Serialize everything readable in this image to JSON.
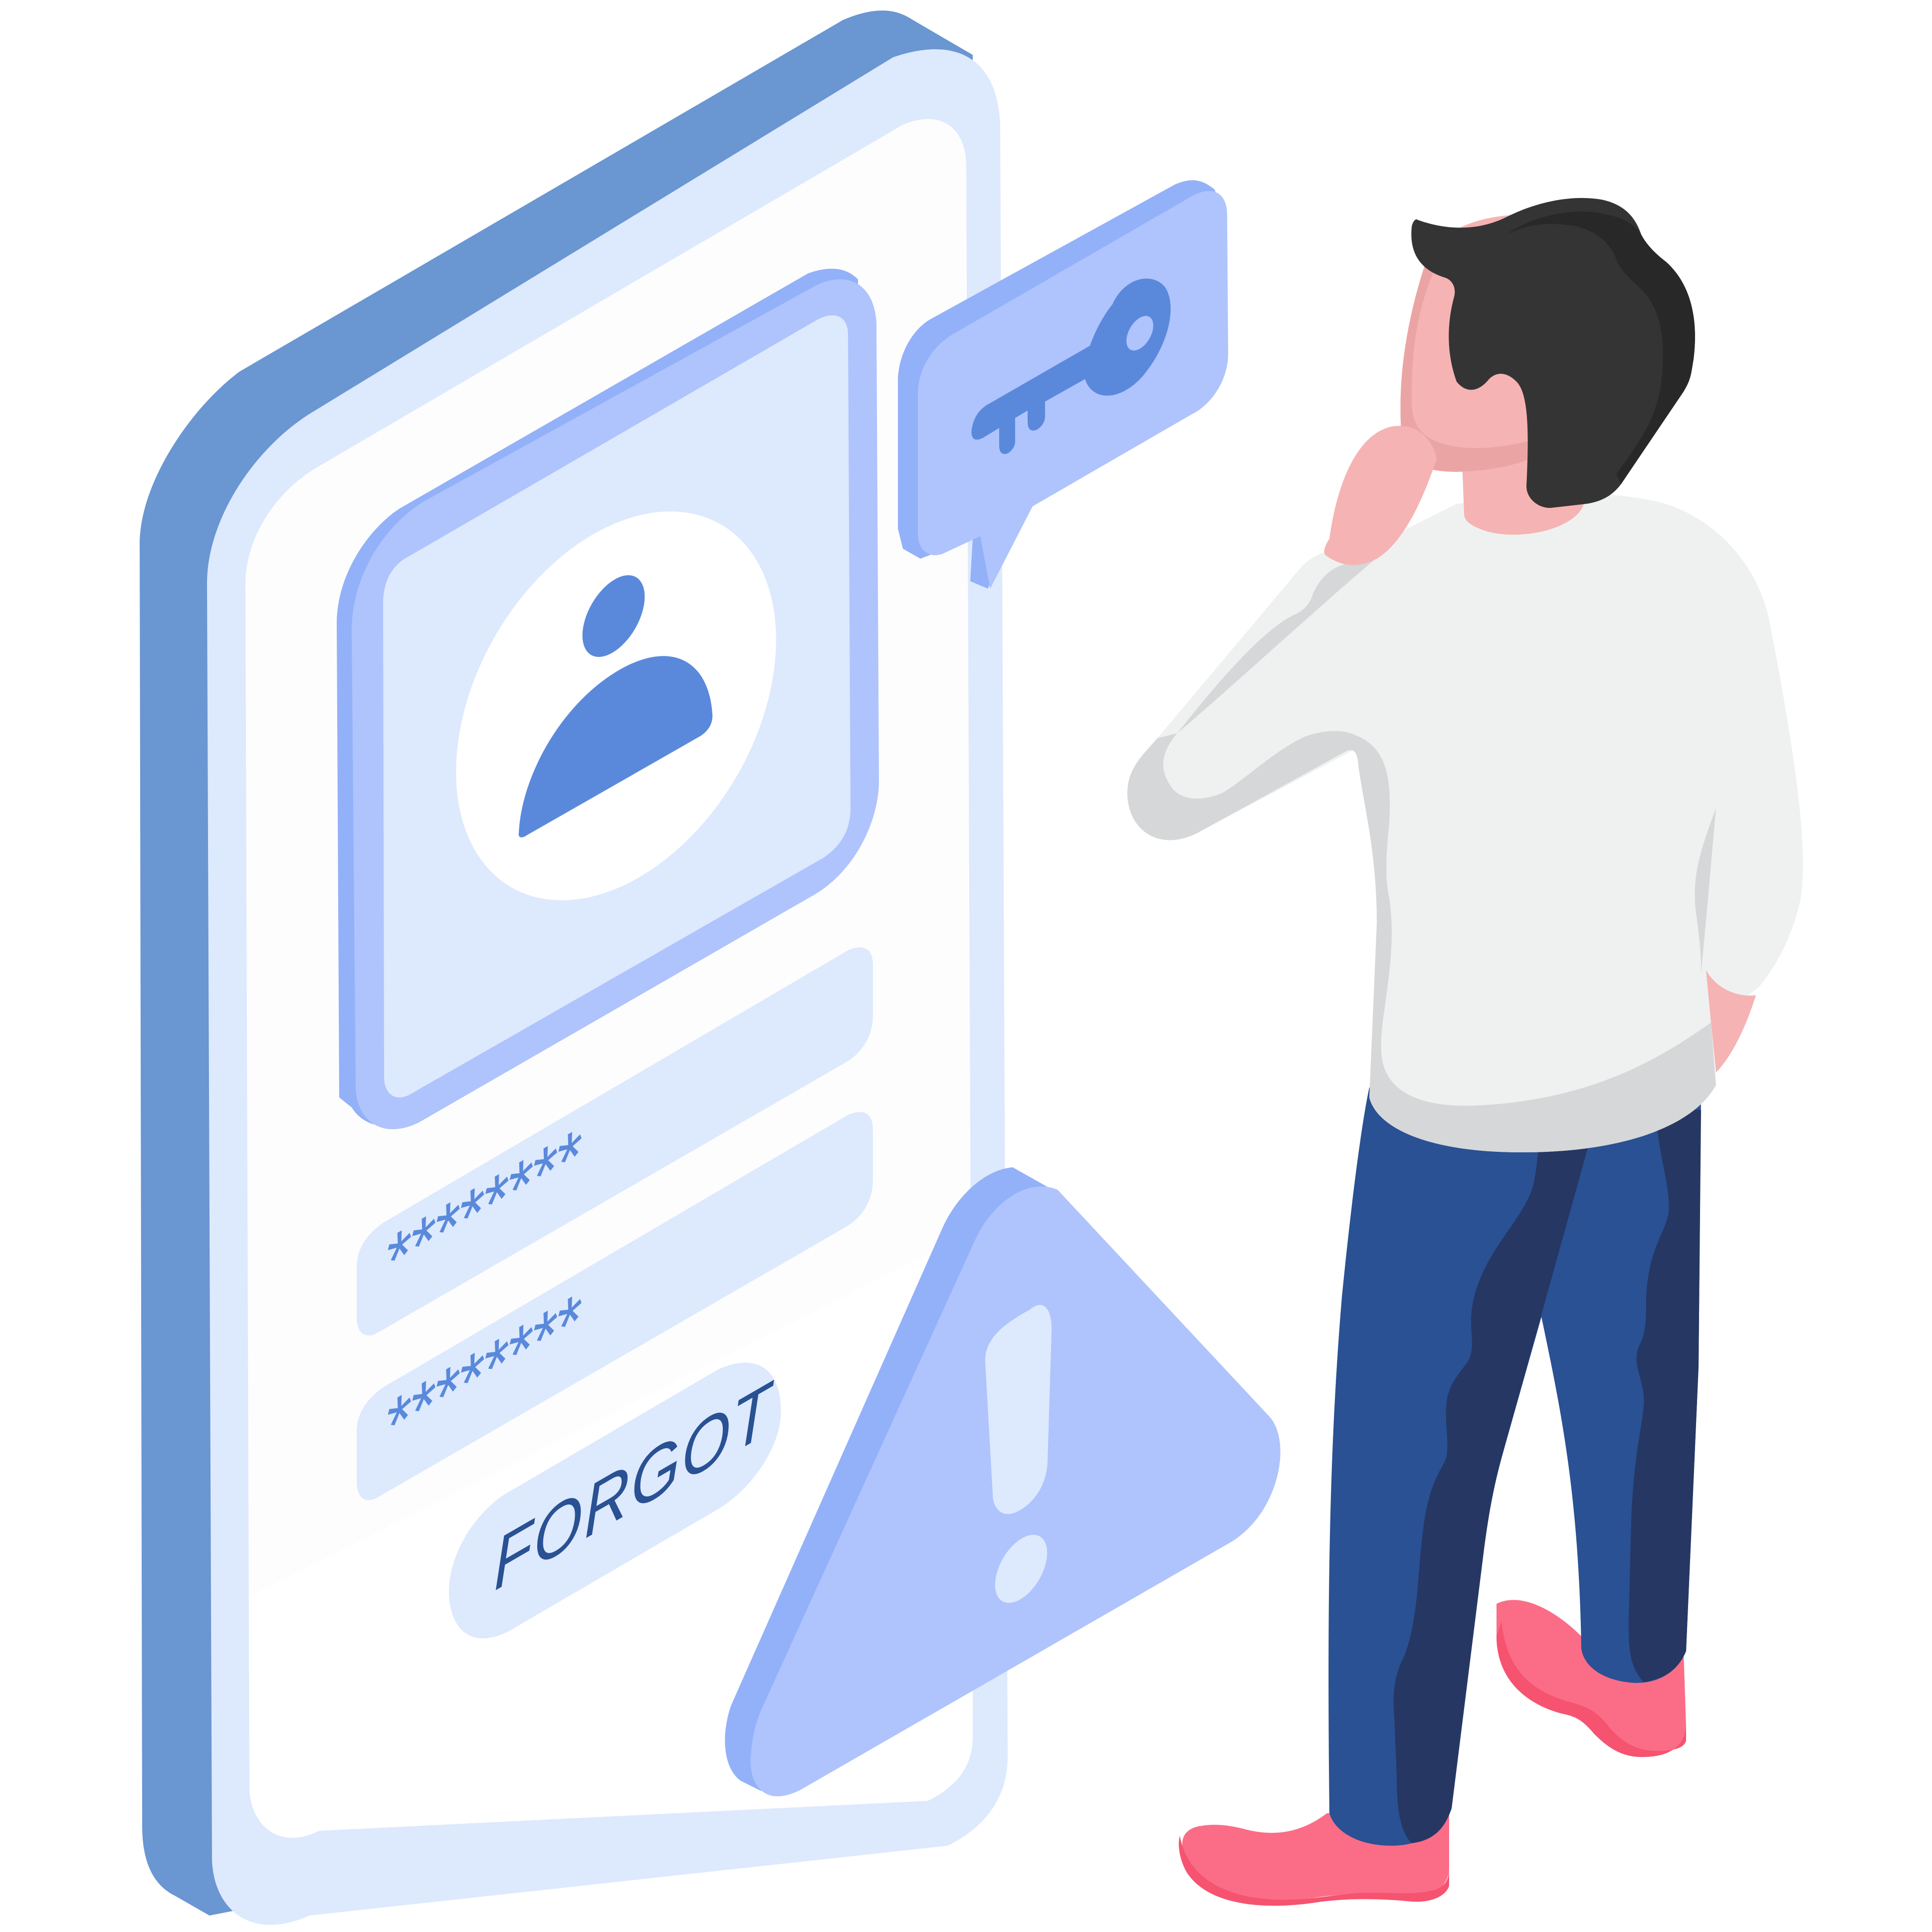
{
  "illustration": {
    "phone": {
      "username_field": "********",
      "password_field": "********",
      "forgot_button": "FORGOT",
      "avatar_icon": "user-icon"
    },
    "key_bubble_icon": "key-icon",
    "warning_icon": "exclamation-icon"
  },
  "colors": {
    "phone_side": "#6a96d2",
    "phone_face": "#dde9fd",
    "phone_screen": "#fdfdfe",
    "card_border": "#afc3fd",
    "card_face": "#dde9fd",
    "accent": "#5a89dc",
    "bubble": "#afc3fd",
    "bubble_shade": "#93b1f8",
    "warning": "#afc3fd",
    "shirt": "#eff1f0",
    "pants": "#295193",
    "shoes": "#fb6d86",
    "skin": "#f6b3b3",
    "hair": "#343434"
  }
}
